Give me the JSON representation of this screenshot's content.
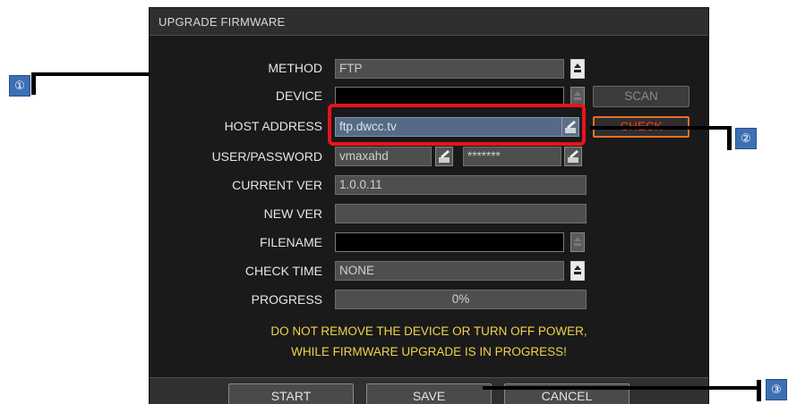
{
  "dialog": {
    "title": "UPGRADE FIRMWARE",
    "rows": {
      "method": {
        "label": "METHOD",
        "value": "FTP"
      },
      "device": {
        "label": "DEVICE",
        "value": ""
      },
      "host": {
        "label": "HOST ADDRESS",
        "value": "ftp.dwcc.tv"
      },
      "user": {
        "label": "USER/PASSWORD",
        "user": "vmaxahd",
        "password": "*******"
      },
      "current_ver": {
        "label": "CURRENT VER",
        "value": "1.0.0.11"
      },
      "new_ver": {
        "label": "NEW VER",
        "value": ""
      },
      "filename": {
        "label": "FILENAME",
        "value": ""
      },
      "check_time": {
        "label": "CHECK TIME",
        "value": "NONE"
      },
      "progress": {
        "label": "PROGRESS",
        "value": "0%",
        "fraction": 0
      }
    },
    "scan_label": "SCAN",
    "check_label": "CHECK",
    "warning_line1": "DO NOT REMOVE THE DEVICE OR TURN OFF POWER,",
    "warning_line2": "WHILE FIRMWARE UPGRADE IS IN PROGRESS!",
    "footer": {
      "start": "START",
      "save": "SAVE",
      "cancel": "CANCEL"
    }
  },
  "callouts": {
    "one": "①",
    "two": "②",
    "three": "③"
  },
  "icons": {
    "dropdown": "up-arrow-icon",
    "edit": "pencil-keyboard-icon"
  },
  "colors": {
    "warning": "#f2d24a",
    "highlight": "#e8131b",
    "check_button": "#ff3a1c",
    "callout": "#3d6fb4"
  }
}
